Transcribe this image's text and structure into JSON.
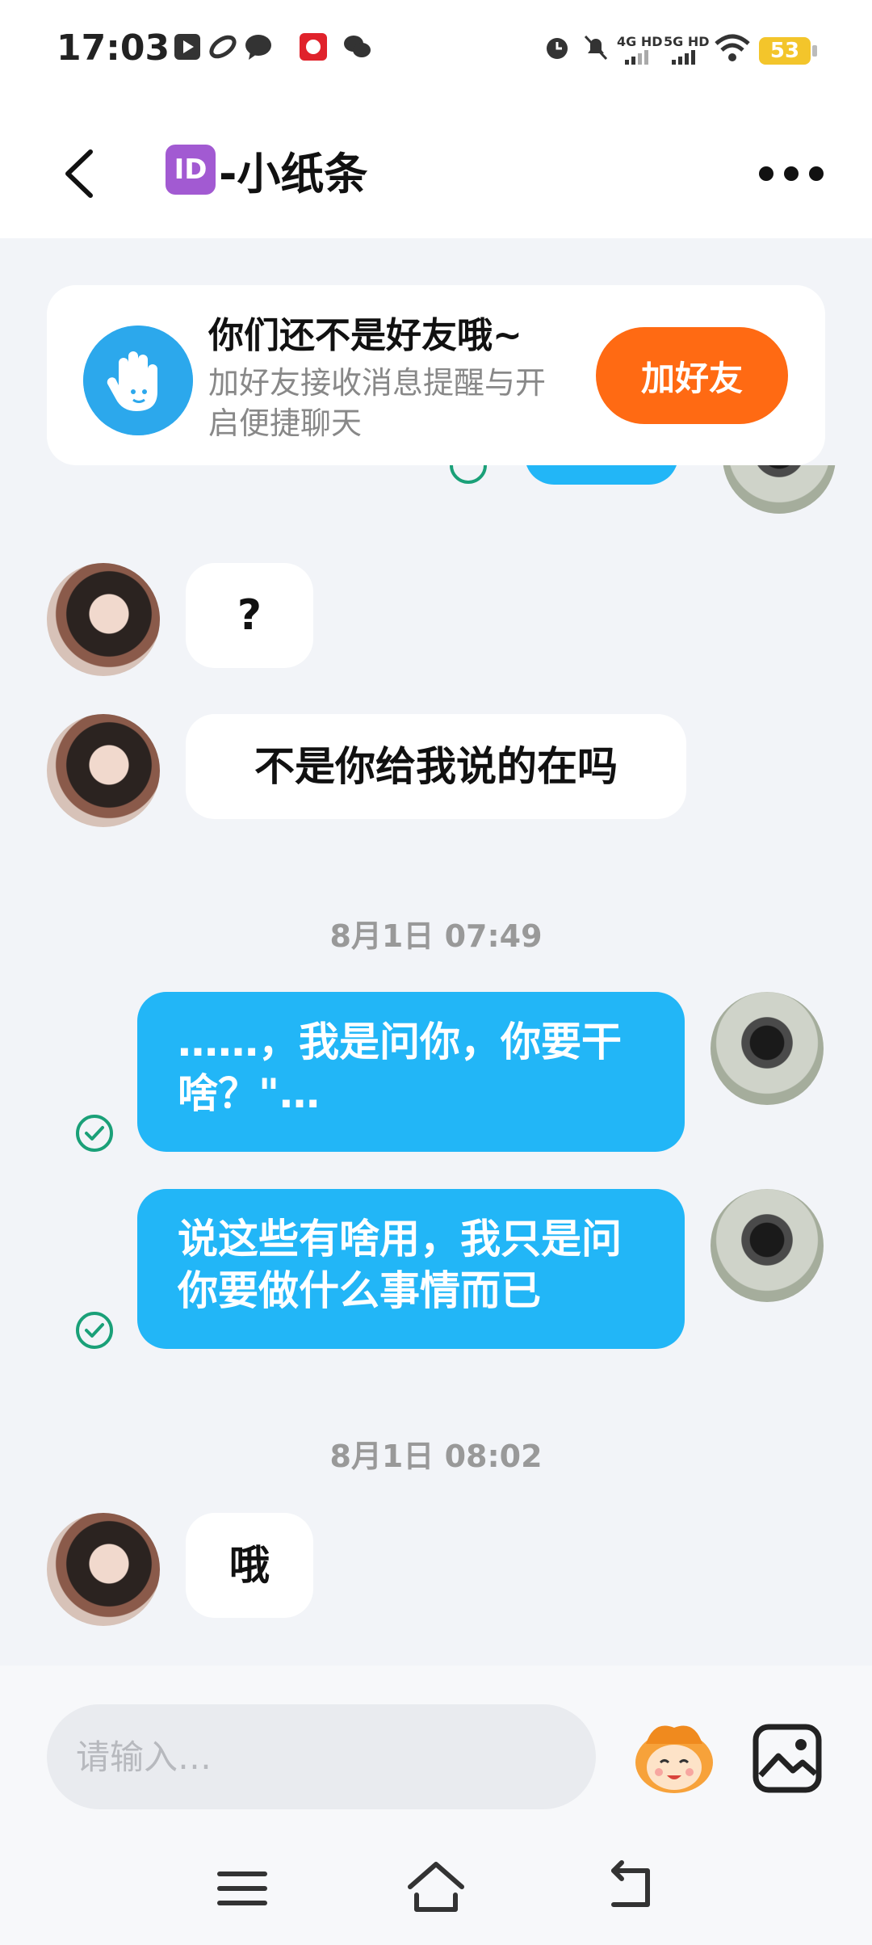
{
  "status": {
    "time": "17:03",
    "network_1": "4G HD",
    "network_2": "5G HD",
    "battery": "53"
  },
  "header": {
    "id_badge": "ID",
    "title": "-小纸条"
  },
  "friend_card": {
    "title": "你们还不是好友哦~",
    "subtitle": "加好友接收消息提醒与开启便捷聊天",
    "button_label": "加好友"
  },
  "messages": [
    {
      "side": "in",
      "text": "?"
    },
    {
      "side": "in",
      "text": "不是你给我说的在吗"
    },
    {
      "side": "out",
      "text": "……，我是问你，你要干啥？\"…"
    },
    {
      "side": "out",
      "text": "说这些有啥用，我只是问你要做什么事情而已"
    },
    {
      "side": "in",
      "text": "哦"
    }
  ],
  "timestamps": [
    "8月1日 07:49",
    "8月1日 08:02"
  ],
  "input": {
    "placeholder": "请输入…"
  },
  "colors": {
    "accent_blue": "#22b6f7",
    "add_friend_orange": "#ff6a13",
    "read_check_green": "#1aa078"
  },
  "icons": [
    "back-arrow-icon",
    "more-dots-icon",
    "hand-wave-icon",
    "read-check-icon",
    "emoji-mascot-icon",
    "image-icon",
    "menu-icon",
    "home-icon",
    "back-nav-icon"
  ]
}
